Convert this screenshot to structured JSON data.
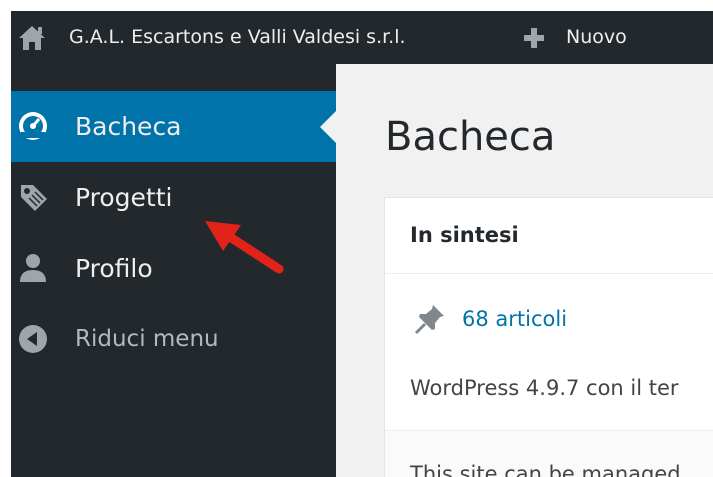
{
  "adminbar": {
    "home_icon": "wordpress-home-icon",
    "site_name": "G.A.L. Escartons e Valli Valdesi s.r.l.",
    "new_icon": "plus-icon",
    "new_label": "Nuovo"
  },
  "sidebar": {
    "items": [
      {
        "label": "Bacheca",
        "icon": "dashboard-gauge-icon",
        "active": true
      },
      {
        "label": "Progetti",
        "icon": "tag-icon",
        "active": false
      },
      {
        "label": "Profilo",
        "icon": "user-icon",
        "active": false
      },
      {
        "label": "Riduci menu",
        "icon": "collapse-arrow-icon",
        "active": false
      }
    ]
  },
  "main": {
    "title": "Bacheca",
    "panel": {
      "title": "In sintesi",
      "articles_link": "68 articoli",
      "wp_version_text": "WordPress 4.9.7 con il ter",
      "footer_text": "This site can be managed"
    }
  },
  "annotation": {
    "arrow_color": "#e2231a"
  },
  "colors": {
    "adminbar_bg": "#23282d",
    "accent": "#0073aa",
    "text_light": "#eeeeee"
  }
}
